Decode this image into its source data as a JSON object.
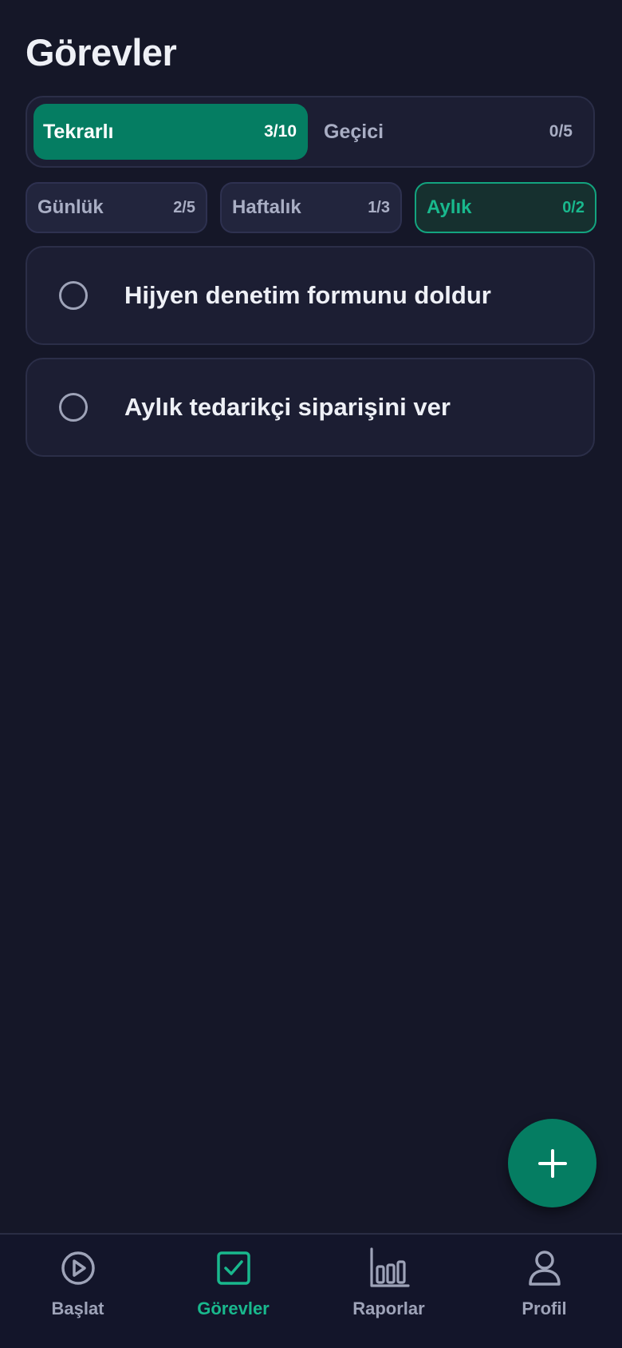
{
  "header": {
    "title": "Görevler"
  },
  "segment": {
    "items": [
      {
        "label": "Tekrarlı",
        "count": "3/10",
        "active": true
      },
      {
        "label": "Geçici",
        "count": "0/5",
        "active": false
      }
    ]
  },
  "periods": {
    "items": [
      {
        "label": "Günlük",
        "count": "2/5",
        "active": false
      },
      {
        "label": "Haftalık",
        "count": "1/3",
        "active": false
      },
      {
        "label": "Aylık",
        "count": "0/2",
        "active": true
      }
    ]
  },
  "tasks": [
    {
      "title": "Hijyen denetim formunu doldur",
      "done": false
    },
    {
      "title": "Aylık tedarikçi siparişini ver",
      "done": false
    }
  ],
  "fab": {
    "icon": "plus-icon"
  },
  "bottom_nav": {
    "items": [
      {
        "label": "Başlat",
        "icon": "play-circle-icon",
        "active": false
      },
      {
        "label": "Görevler",
        "icon": "checkbox-icon",
        "active": true
      },
      {
        "label": "Raporlar",
        "icon": "bar-chart-icon",
        "active": false
      },
      {
        "label": "Profil",
        "icon": "user-icon",
        "active": false
      }
    ]
  },
  "colors": {
    "background": "#151728",
    "card": "#1c1e33",
    "accent": "#057d62",
    "accent_text": "#19b88d",
    "muted_text": "#a9aec4"
  }
}
